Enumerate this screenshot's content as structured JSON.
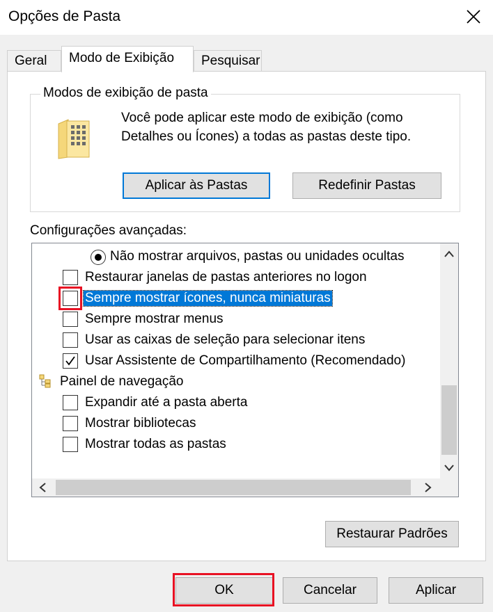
{
  "window": {
    "title": "Opções de Pasta"
  },
  "tabs": [
    {
      "label": "Geral"
    },
    {
      "label": "Modo de Exibição"
    },
    {
      "label": "Pesquisar"
    }
  ],
  "folder_views": {
    "legend": "Modos de exibição de pasta",
    "description_line1": "Você pode aplicar este modo de exibição (como",
    "description_line2": "Detalhes ou Ícones) a todas as pastas deste tipo.",
    "apply_button": "Aplicar às Pastas",
    "reset_button": "Redefinir Pastas"
  },
  "advanced": {
    "label": "Configurações avançadas:",
    "items": [
      {
        "type": "radio",
        "label": "Não mostrar arquivos, pastas ou unidades ocultas",
        "checked": true
      },
      {
        "type": "checkbox",
        "label": "Restaurar janelas de pastas anteriores no logon",
        "checked": false
      },
      {
        "type": "checkbox",
        "label": "Sempre mostrar ícones, nunca miniaturas",
        "checked": false,
        "selected": true
      },
      {
        "type": "checkbox",
        "label": "Sempre mostrar menus",
        "checked": false
      },
      {
        "type": "checkbox",
        "label": "Usar as caixas de seleção para selecionar itens",
        "checked": false
      },
      {
        "type": "checkbox",
        "label": "Usar Assistente de Compartilhamento (Recomendado)",
        "checked": true
      },
      {
        "type": "group",
        "label": "Painel de navegação"
      },
      {
        "type": "checkbox",
        "label": "Expandir até a pasta aberta",
        "checked": false
      },
      {
        "type": "checkbox",
        "label": "Mostrar bibliotecas",
        "checked": false
      },
      {
        "type": "checkbox",
        "label": "Mostrar todas as pastas",
        "checked": false
      }
    ],
    "restore_defaults_button": "Restaurar Padrões"
  },
  "footer": {
    "ok_button": "OK",
    "cancel_button": "Cancelar",
    "apply_button": "Aplicar"
  },
  "colors": {
    "selection": "#0078d7",
    "highlight": "#e81123"
  },
  "icons": {
    "close": "close-icon",
    "folder": "folder-icon",
    "navigation_pane": "navigation-pane-icon"
  }
}
